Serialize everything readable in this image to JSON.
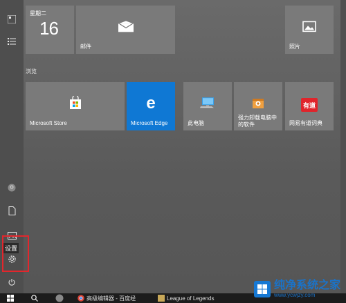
{
  "rail": {
    "settings_tooltip": "设置"
  },
  "tiles": {
    "calendar": {
      "weekday": "星期二",
      "day": "16"
    },
    "mail": {
      "label": "邮件"
    },
    "photos": {
      "label": "照片"
    },
    "group_title": "浏览",
    "store": {
      "label": "Microsoft Store"
    },
    "edge": {
      "label": "Microsoft Edge"
    },
    "this_pc": {
      "label": "此电脑"
    },
    "uninstall": {
      "label_line1": "强力卸载电脑中",
      "label_line2": "的软件"
    },
    "youdao": {
      "label": "网易有道词典",
      "logo_text": "有道"
    }
  },
  "taskbar": {
    "item1": "高级编辑器 - 百度经",
    "item2": "League of Legends"
  },
  "watermark": {
    "title": "纯净系统之家",
    "url": "www.ycwjzy.com"
  },
  "colors": {
    "tile_gray": "#7a7a7a",
    "edge_blue": "#0f78d4",
    "youdao_red": "#e0242b",
    "highlight": "#e3262c"
  }
}
